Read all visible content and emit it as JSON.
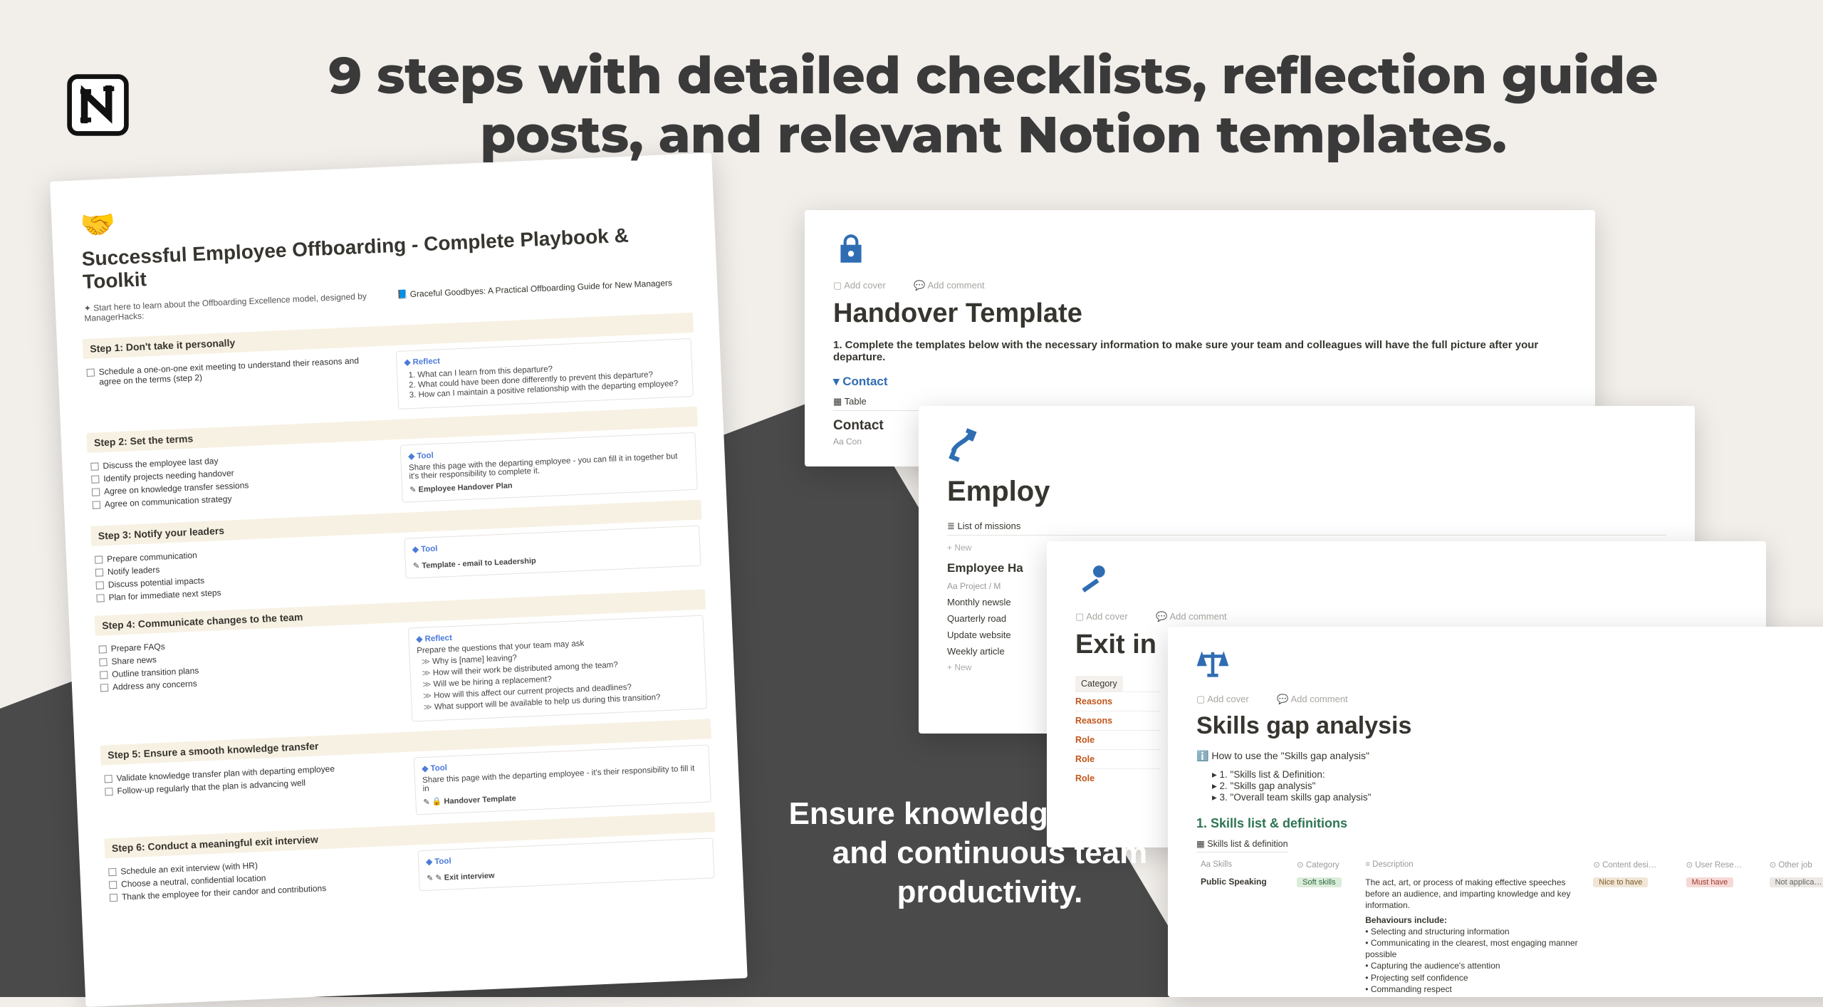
{
  "headline": "9 steps with detailed checklists, reflection guide posts, and relevant Notion templates.",
  "caption": "Ensure knowledge transfer and continuous team productivity.",
  "playbook": {
    "emoji": "🤝",
    "title": "Successful Employee Offboarding - Complete Playbook & Toolkit",
    "intro_left_prefix": "✦ ",
    "intro_left": "Start here to learn about the Offboarding Excellence model, designed by ManagerHacks:",
    "intro_right": "Graceful Goodbyes: A Practical Offboarding Guide for New Managers",
    "steps": [
      {
        "title": "Step 1: Don't take it personally",
        "checks": [
          "Schedule a one-on-one exit meeting to understand their reasons and agree on the terms (step 2)"
        ],
        "callout": {
          "tag": "Reflect",
          "ordered": [
            "What can I learn from this departure?",
            "What could have been done differently to prevent this departure?",
            "How can I maintain a positive relationship with the departing employee?"
          ]
        }
      },
      {
        "title": "Step 2: Set the terms",
        "checks": [
          "Discuss the employee last day",
          "Identify projects needing handover",
          "Agree on knowledge transfer sessions",
          "Agree on communication strategy"
        ],
        "callout": {
          "tag": "Tool",
          "text": "Share this page with the departing employee - you can fill it in together but it's their responsibility to complete it.",
          "link": "Employee Handover Plan"
        }
      },
      {
        "title": "Step 3: Notify your leaders",
        "checks": [
          "Prepare communication",
          "Notify leaders",
          "Discuss potential impacts",
          "Plan for immediate next steps"
        ],
        "callout": {
          "tag": "Tool",
          "link": "Template - email to Leadership"
        }
      },
      {
        "title": "Step 4: Communicate changes to the team",
        "checks": [
          "Prepare FAQs",
          "Share news",
          "Outline transition plans",
          "Address any concerns"
        ],
        "callout": {
          "tag": "Reflect",
          "text": "Prepare the questions that your team may ask",
          "bullets": [
            "Why is [name] leaving?",
            "How will their work be distributed among the team?",
            "Will we be hiring a replacement?",
            "How will this affect our current projects and deadlines?",
            "What support will be available to help us during this transition?"
          ]
        }
      },
      {
        "title": "Step 5: Ensure a smooth knowledge transfer",
        "checks": [
          "Validate knowledge transfer plan with departing employee",
          "Follow-up regularly that the plan is advancing well"
        ],
        "callout": {
          "tag": "Tool",
          "text": "Share this page with the departing employee - it's their responsibility to fill it in",
          "link_icon": "🔒",
          "link": "Handover Template"
        }
      },
      {
        "title": "Step 6: Conduct a meaningful exit interview",
        "checks": [
          "Schedule an exit interview (with HR)",
          "Choose a neutral, confidential location",
          "Thank the employee for their candor and contributions"
        ],
        "callout": {
          "tag": "Tool",
          "link_icon": "✎",
          "link": "Exit interview"
        }
      }
    ]
  },
  "right_toolbar": {
    "add_cover": "Add cover",
    "add_comment": "Add comment"
  },
  "handover": {
    "title": "Handover Template",
    "desc": "1. Complete the templates below with the necessary information to make sure your team and colleagues will have the full picture after your departure.",
    "toggle": "Contact",
    "tab": "Table",
    "sub": "Contact",
    "col_a_prefix": "Aa ",
    "col_a": "Con"
  },
  "employee": {
    "title": "Employ",
    "list_tab": "List of missions",
    "new": "New",
    "sub": "Employee Ha",
    "col_prefix": "Aa ",
    "col": "Project / M",
    "rows": [
      "Monthly newsle",
      "Quarterly road",
      "Update website",
      "Weekly article"
    ]
  },
  "exit": {
    "title": "Exit in",
    "cat_header": "Category",
    "items": [
      "Reasons",
      "Reasons",
      "Role",
      "Role",
      "Role"
    ]
  },
  "skills": {
    "title": "Skills gap analysis",
    "info": "How to use the \"Skills gap analysis\"",
    "toc": [
      "1. \"Skills list & Definition:",
      "2. \"Skills gap analysis\"",
      "3. \"Overall team skills gap analysis\""
    ],
    "section": "1. Skills list & definitions",
    "tab": "Skills list & definition",
    "cols": {
      "skills_prefix": "Aa ",
      "skills": "Skills",
      "category_prefix": "⊙ ",
      "category": "Category",
      "description_prefix": "≡ ",
      "description": "Description",
      "c1_prefix": "⊙ ",
      "c1": "Content desi…",
      "c2_prefix": "⊙ ",
      "c2": "User Rese…",
      "c3_prefix": "⊙ ",
      "c3": "Other job"
    },
    "row": {
      "skill": "Public Speaking",
      "cat_pill": "Soft skills",
      "desc_main": "The act, art, or process of making effective speeches before an audience, and imparting knowledge and key information.",
      "desc_head": "Behaviours include:",
      "desc_bullets": [
        "Selecting and structuring information",
        "Communicating in the clearest, most engaging manner possible",
        "Capturing the audience's attention",
        "Projecting self confidence",
        "Commanding respect"
      ],
      "p1": "Nice to have",
      "p2": "Must have",
      "p3": "Not applica…"
    }
  }
}
